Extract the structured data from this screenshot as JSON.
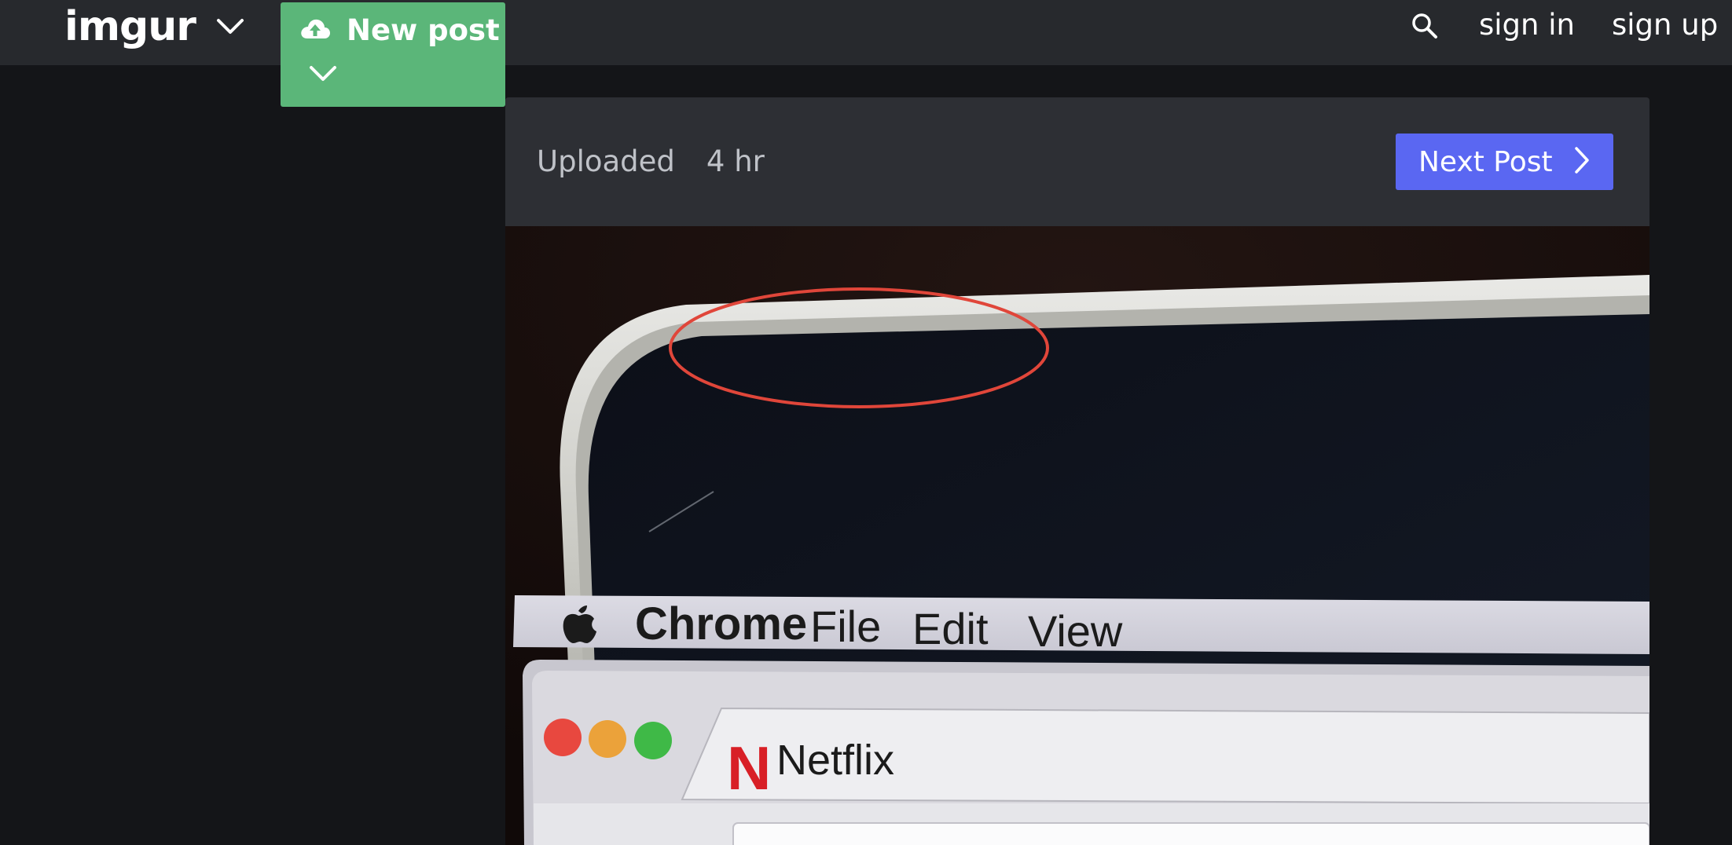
{
  "header": {
    "logo_text": "imgur",
    "new_post_label": "New post",
    "sign_in": "sign in",
    "sign_up": "sign up",
    "icons": [
      "chevron-down-icon",
      "upload-cloud-icon",
      "search-icon"
    ]
  },
  "post": {
    "uploaded_label": "Uploaded",
    "age": "4 hr",
    "next_post_label": "Next Post"
  },
  "photo": {
    "menu_bar": {
      "app": "Chrome",
      "items": [
        "File",
        "Edit",
        "View"
      ]
    },
    "tab_title": "Netflix",
    "netflix_logo": "N",
    "annotation_color": "#e0463a"
  },
  "colors": {
    "topbar": "#27292d",
    "background": "#141518",
    "new_post_green": "#5bb679",
    "next_post_blue": "#5a67f2"
  }
}
